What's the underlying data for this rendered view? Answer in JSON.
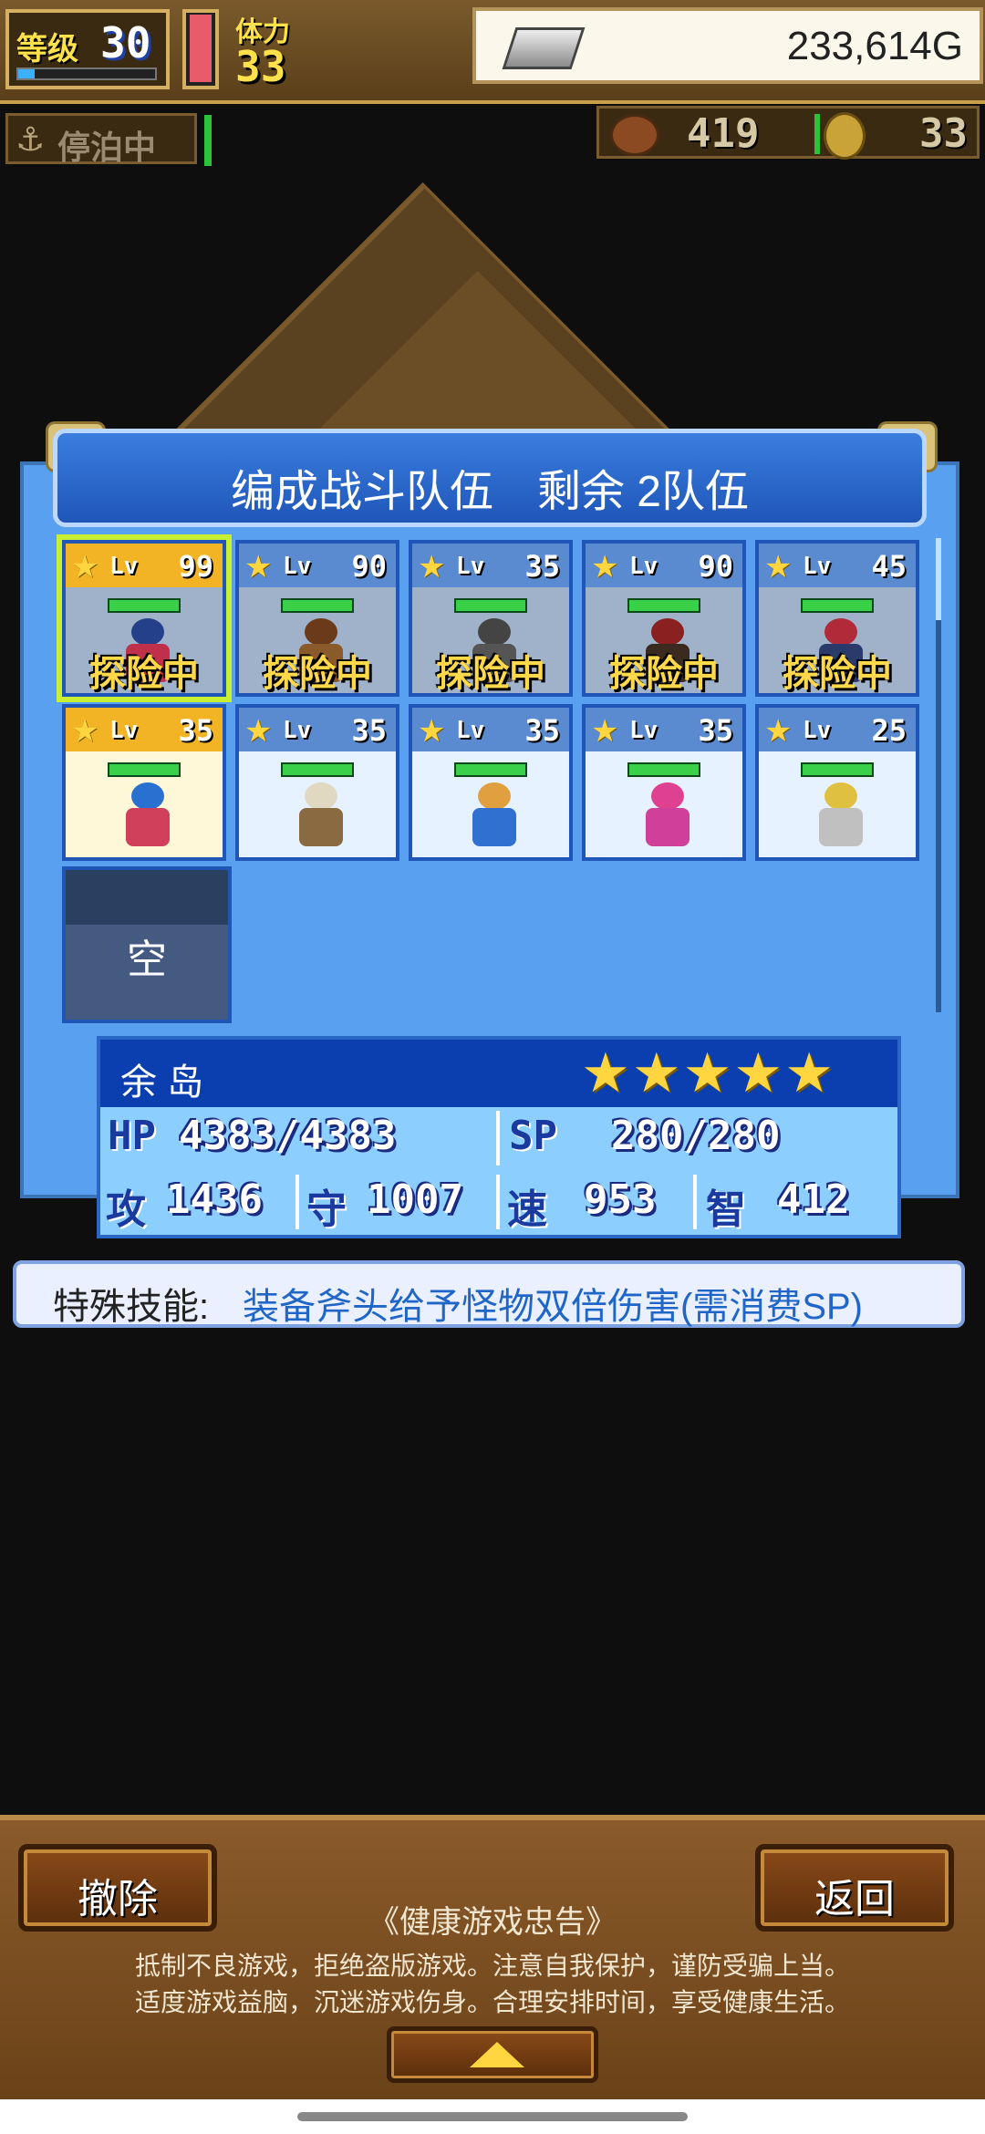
{
  "hud": {
    "level_label": "等级",
    "level": "30",
    "stamina_label": "体力",
    "stamina": "33",
    "gold": "233,614G",
    "dock_status": "停泊中",
    "food": "419",
    "coins": "33"
  },
  "dialog": {
    "title": "编成战斗队伍　剩余 2队伍",
    "cells": [
      {
        "lv_label": "Lv",
        "lv": "99",
        "status": "探险中"
      },
      {
        "lv_label": "Lv",
        "lv": "90",
        "status": "探险中"
      },
      {
        "lv_label": "Lv",
        "lv": "35",
        "status": "探险中"
      },
      {
        "lv_label": "Lv",
        "lv": "90",
        "status": "探险中"
      },
      {
        "lv_label": "Lv",
        "lv": "45",
        "status": "探险中"
      },
      {
        "lv_label": "Lv",
        "lv": "35"
      },
      {
        "lv_label": "Lv",
        "lv": "35"
      },
      {
        "lv_label": "Lv",
        "lv": "35"
      },
      {
        "lv_label": "Lv",
        "lv": "35"
      },
      {
        "lv_label": "Lv",
        "lv": "25"
      }
    ],
    "empty_label": "空"
  },
  "stats": {
    "name": "余 岛",
    "stars": "★★★★★",
    "hp_label": "HP",
    "hp": "4383/4383",
    "sp_label": "SP",
    "sp": "280/280",
    "atk_label": "攻",
    "atk": "1436",
    "def_label": "守",
    "def": "1007",
    "spd_label": "速",
    "spd": "953",
    "int_label": "智",
    "int": "412"
  },
  "skill": {
    "label": "特殊技能:",
    "text": "装备斧头给予怪物双倍伤害(需消费SP)"
  },
  "bottom": {
    "remove_label": "撤除",
    "back_label": "返回",
    "notice_title": "《健康游戏忠告》",
    "notice_line1": "抵制不良游戏，拒绝盗版游戏。注意自我保护，谨防受骗上当。",
    "notice_line2": "适度游戏益脑，沉迷游戏伤身。合理安排时间，享受健康生活。"
  }
}
